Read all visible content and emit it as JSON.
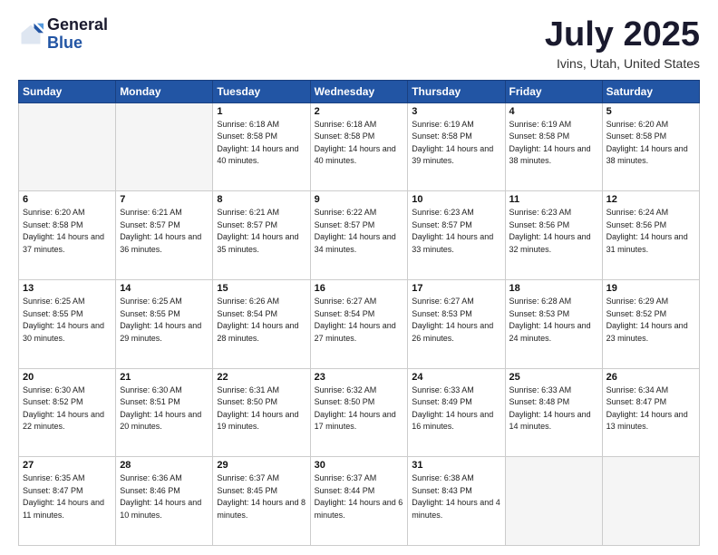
{
  "logo": {
    "general": "General",
    "blue": "Blue"
  },
  "header": {
    "month": "July 2025",
    "location": "Ivins, Utah, United States"
  },
  "weekdays": [
    "Sunday",
    "Monday",
    "Tuesday",
    "Wednesday",
    "Thursday",
    "Friday",
    "Saturday"
  ],
  "weeks": [
    [
      {
        "day": "",
        "sunrise": "",
        "sunset": "",
        "daylight": ""
      },
      {
        "day": "",
        "sunrise": "",
        "sunset": "",
        "daylight": ""
      },
      {
        "day": "1",
        "sunrise": "Sunrise: 6:18 AM",
        "sunset": "Sunset: 8:58 PM",
        "daylight": "Daylight: 14 hours and 40 minutes."
      },
      {
        "day": "2",
        "sunrise": "Sunrise: 6:18 AM",
        "sunset": "Sunset: 8:58 PM",
        "daylight": "Daylight: 14 hours and 40 minutes."
      },
      {
        "day": "3",
        "sunrise": "Sunrise: 6:19 AM",
        "sunset": "Sunset: 8:58 PM",
        "daylight": "Daylight: 14 hours and 39 minutes."
      },
      {
        "day": "4",
        "sunrise": "Sunrise: 6:19 AM",
        "sunset": "Sunset: 8:58 PM",
        "daylight": "Daylight: 14 hours and 38 minutes."
      },
      {
        "day": "5",
        "sunrise": "Sunrise: 6:20 AM",
        "sunset": "Sunset: 8:58 PM",
        "daylight": "Daylight: 14 hours and 38 minutes."
      }
    ],
    [
      {
        "day": "6",
        "sunrise": "Sunrise: 6:20 AM",
        "sunset": "Sunset: 8:58 PM",
        "daylight": "Daylight: 14 hours and 37 minutes."
      },
      {
        "day": "7",
        "sunrise": "Sunrise: 6:21 AM",
        "sunset": "Sunset: 8:57 PM",
        "daylight": "Daylight: 14 hours and 36 minutes."
      },
      {
        "day": "8",
        "sunrise": "Sunrise: 6:21 AM",
        "sunset": "Sunset: 8:57 PM",
        "daylight": "Daylight: 14 hours and 35 minutes."
      },
      {
        "day": "9",
        "sunrise": "Sunrise: 6:22 AM",
        "sunset": "Sunset: 8:57 PM",
        "daylight": "Daylight: 14 hours and 34 minutes."
      },
      {
        "day": "10",
        "sunrise": "Sunrise: 6:23 AM",
        "sunset": "Sunset: 8:57 PM",
        "daylight": "Daylight: 14 hours and 33 minutes."
      },
      {
        "day": "11",
        "sunrise": "Sunrise: 6:23 AM",
        "sunset": "Sunset: 8:56 PM",
        "daylight": "Daylight: 14 hours and 32 minutes."
      },
      {
        "day": "12",
        "sunrise": "Sunrise: 6:24 AM",
        "sunset": "Sunset: 8:56 PM",
        "daylight": "Daylight: 14 hours and 31 minutes."
      }
    ],
    [
      {
        "day": "13",
        "sunrise": "Sunrise: 6:25 AM",
        "sunset": "Sunset: 8:55 PM",
        "daylight": "Daylight: 14 hours and 30 minutes."
      },
      {
        "day": "14",
        "sunrise": "Sunrise: 6:25 AM",
        "sunset": "Sunset: 8:55 PM",
        "daylight": "Daylight: 14 hours and 29 minutes."
      },
      {
        "day": "15",
        "sunrise": "Sunrise: 6:26 AM",
        "sunset": "Sunset: 8:54 PM",
        "daylight": "Daylight: 14 hours and 28 minutes."
      },
      {
        "day": "16",
        "sunrise": "Sunrise: 6:27 AM",
        "sunset": "Sunset: 8:54 PM",
        "daylight": "Daylight: 14 hours and 27 minutes."
      },
      {
        "day": "17",
        "sunrise": "Sunrise: 6:27 AM",
        "sunset": "Sunset: 8:53 PM",
        "daylight": "Daylight: 14 hours and 26 minutes."
      },
      {
        "day": "18",
        "sunrise": "Sunrise: 6:28 AM",
        "sunset": "Sunset: 8:53 PM",
        "daylight": "Daylight: 14 hours and 24 minutes."
      },
      {
        "day": "19",
        "sunrise": "Sunrise: 6:29 AM",
        "sunset": "Sunset: 8:52 PM",
        "daylight": "Daylight: 14 hours and 23 minutes."
      }
    ],
    [
      {
        "day": "20",
        "sunrise": "Sunrise: 6:30 AM",
        "sunset": "Sunset: 8:52 PM",
        "daylight": "Daylight: 14 hours and 22 minutes."
      },
      {
        "day": "21",
        "sunrise": "Sunrise: 6:30 AM",
        "sunset": "Sunset: 8:51 PM",
        "daylight": "Daylight: 14 hours and 20 minutes."
      },
      {
        "day": "22",
        "sunrise": "Sunrise: 6:31 AM",
        "sunset": "Sunset: 8:50 PM",
        "daylight": "Daylight: 14 hours and 19 minutes."
      },
      {
        "day": "23",
        "sunrise": "Sunrise: 6:32 AM",
        "sunset": "Sunset: 8:50 PM",
        "daylight": "Daylight: 14 hours and 17 minutes."
      },
      {
        "day": "24",
        "sunrise": "Sunrise: 6:33 AM",
        "sunset": "Sunset: 8:49 PM",
        "daylight": "Daylight: 14 hours and 16 minutes."
      },
      {
        "day": "25",
        "sunrise": "Sunrise: 6:33 AM",
        "sunset": "Sunset: 8:48 PM",
        "daylight": "Daylight: 14 hours and 14 minutes."
      },
      {
        "day": "26",
        "sunrise": "Sunrise: 6:34 AM",
        "sunset": "Sunset: 8:47 PM",
        "daylight": "Daylight: 14 hours and 13 minutes."
      }
    ],
    [
      {
        "day": "27",
        "sunrise": "Sunrise: 6:35 AM",
        "sunset": "Sunset: 8:47 PM",
        "daylight": "Daylight: 14 hours and 11 minutes."
      },
      {
        "day": "28",
        "sunrise": "Sunrise: 6:36 AM",
        "sunset": "Sunset: 8:46 PM",
        "daylight": "Daylight: 14 hours and 10 minutes."
      },
      {
        "day": "29",
        "sunrise": "Sunrise: 6:37 AM",
        "sunset": "Sunset: 8:45 PM",
        "daylight": "Daylight: 14 hours and 8 minutes."
      },
      {
        "day": "30",
        "sunrise": "Sunrise: 6:37 AM",
        "sunset": "Sunset: 8:44 PM",
        "daylight": "Daylight: 14 hours and 6 minutes."
      },
      {
        "day": "31",
        "sunrise": "Sunrise: 6:38 AM",
        "sunset": "Sunset: 8:43 PM",
        "daylight": "Daylight: 14 hours and 4 minutes."
      },
      {
        "day": "",
        "sunrise": "",
        "sunset": "",
        "daylight": ""
      },
      {
        "day": "",
        "sunrise": "",
        "sunset": "",
        "daylight": ""
      }
    ]
  ]
}
